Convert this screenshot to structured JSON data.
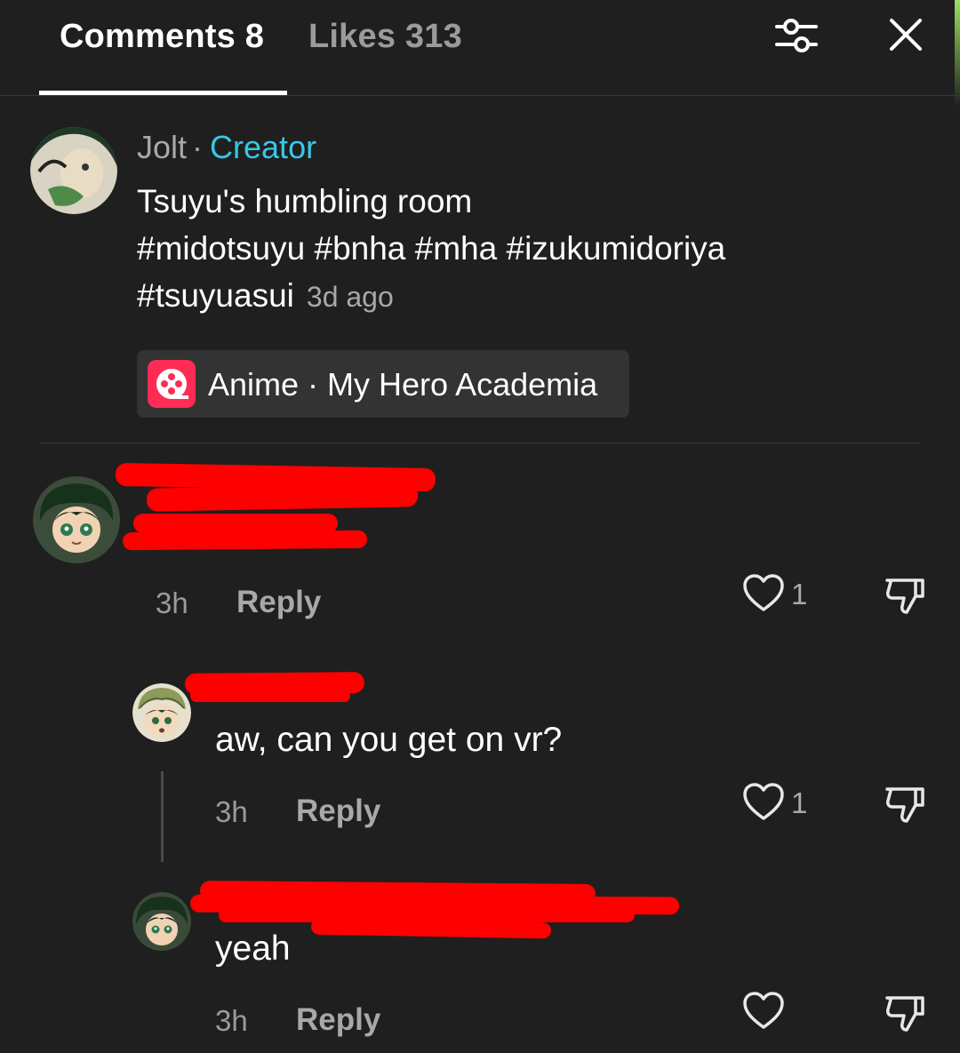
{
  "header": {
    "tabs": [
      {
        "label": "Comments 8",
        "active": true
      },
      {
        "label": "Likes 313",
        "active": false
      }
    ],
    "icons": [
      "sliders-icon",
      "close-icon"
    ]
  },
  "post": {
    "author": "Jolt",
    "separator": "·",
    "badge": "Creator",
    "caption_line1": "Tsuyu's humbling room",
    "caption_line2": "#midotsuyu #bnha #mha #izukumidoriya",
    "caption_line3": "#tsuyuasui",
    "time": "3d ago",
    "topic": "Anime · My Hero Academia"
  },
  "comments": [
    {
      "username": "",
      "text": "",
      "time": "3h",
      "reply_label": "Reply",
      "likes": "1"
    },
    {
      "username": "",
      "text": "aw, can you get on vr?",
      "time": "3h",
      "reply_label": "Reply",
      "likes": "1"
    },
    {
      "username": "",
      "text": "yeah",
      "time": "3h",
      "reply_label": "Reply",
      "likes": ""
    }
  ],
  "colors": {
    "background": "#1f1f1f",
    "creator_badge": "#36c8ea",
    "topic_icon": "#fe2c55",
    "redaction": "#ff0000"
  }
}
